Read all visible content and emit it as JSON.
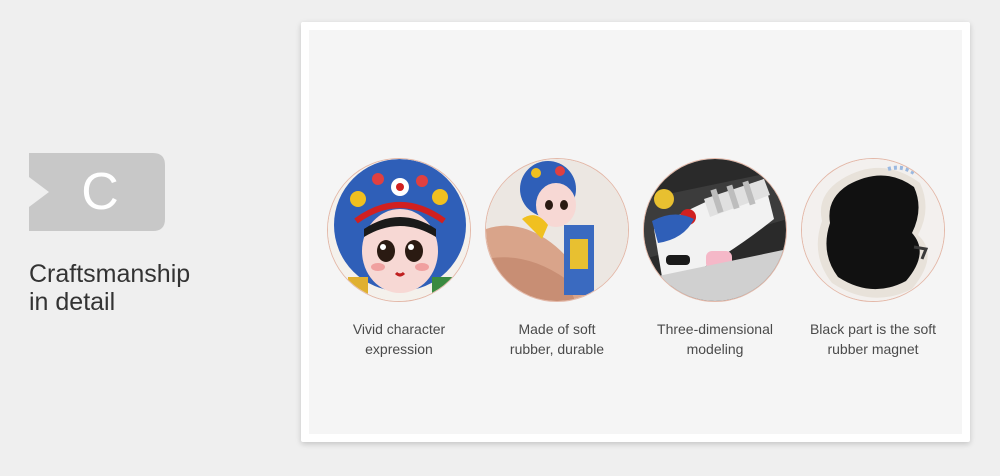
{
  "section": {
    "badge_letter": "C",
    "title_line1": "Craftsmanship",
    "title_line2": "in detail"
  },
  "colors": {
    "badge": "#c8c8c8",
    "circle_border": "#e3b8a8",
    "text": "#333333"
  },
  "features": [
    {
      "caption_line1": "Vivid character",
      "caption_line2": "expression",
      "image": "opera-doll-face-photo"
    },
    {
      "caption_line1": "Made of soft",
      "caption_line2": "rubber, durable",
      "image": "hand-holding-magnet-photo"
    },
    {
      "caption_line1": "Three-dimensional",
      "caption_line2": "modeling",
      "image": "3d-modeling-closeup-photo"
    },
    {
      "caption_line1": "Black part is the soft",
      "caption_line2": "rubber magnet",
      "image": "magnet-back-photo"
    }
  ]
}
